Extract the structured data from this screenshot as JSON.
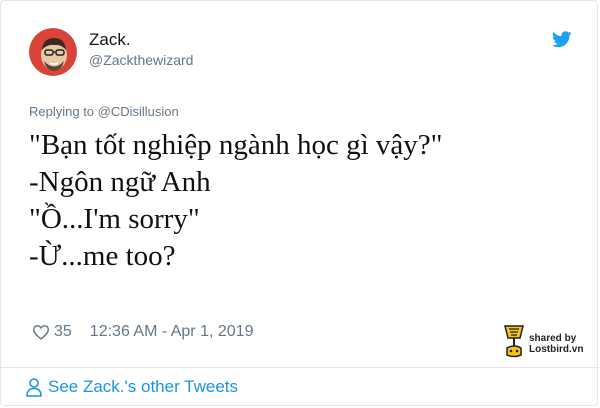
{
  "user": {
    "name": "Zack.",
    "handle": "@Zackthewizard",
    "avatar_icon": "cartoon-avatar"
  },
  "reply": {
    "text": "Replying to @CDisillusion"
  },
  "tweet": {
    "lines": [
      "\"Bạn tốt nghiệp ngành học gì vậy?\"",
      "-Ngôn ngữ Anh",
      "\"Ồ...I'm sorry\"",
      "-Ừ...me too?"
    ]
  },
  "meta": {
    "likes": "35",
    "timestamp": "12:36 AM - Apr 1, 2019"
  },
  "watermark": {
    "line1": "shared by",
    "line2": "Lostbird.vn"
  },
  "footer": {
    "link_text": "See Zack.'s other Tweets"
  },
  "colors": {
    "twitter_blue": "#1da1f2",
    "link_blue": "#1b95e0",
    "muted_gray": "#657786",
    "avatar_red": "#d9433a"
  }
}
